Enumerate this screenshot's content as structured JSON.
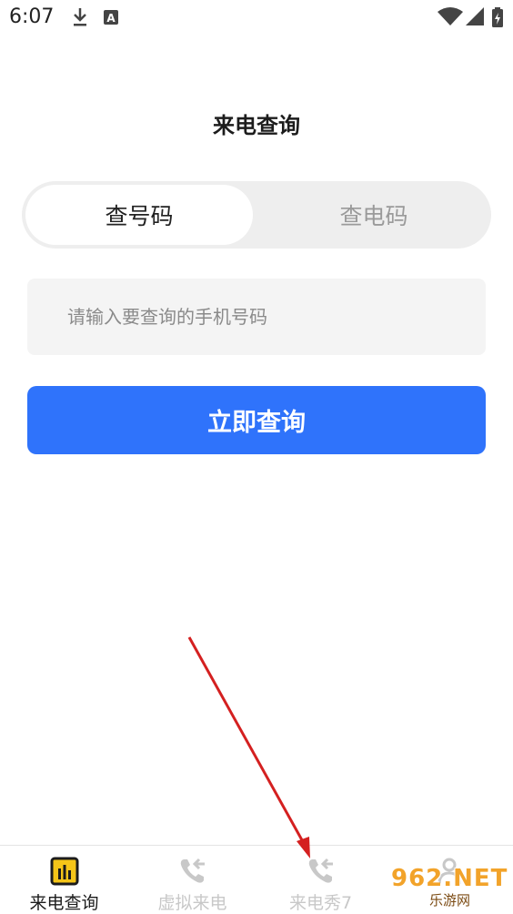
{
  "status_bar": {
    "time": "6:07",
    "icons": [
      "download-icon",
      "a-notification-icon",
      "wifi-icon",
      "signal-icon",
      "battery-icon"
    ]
  },
  "page": {
    "title": "来电查询"
  },
  "segmented": {
    "tabs": [
      {
        "label": "查号码",
        "active": true
      },
      {
        "label": "查电码",
        "active": false
      }
    ]
  },
  "search": {
    "placeholder": "请输入要查询的手机号码",
    "value": ""
  },
  "query_button": {
    "label": "立即查询"
  },
  "bottom_nav": {
    "items": [
      {
        "label": "来电查询",
        "icon": "bar-chart-icon",
        "active": true
      },
      {
        "label": "虚拟来电",
        "icon": "phone-callback-icon",
        "active": false
      },
      {
        "label": "来电秀7",
        "icon": "phone-callback-icon",
        "active": false
      },
      {
        "label": "",
        "icon": "person-icon",
        "active": false
      }
    ]
  },
  "watermark": {
    "main": "962.NET",
    "sub": "乐游网"
  },
  "colors": {
    "accent": "#2f73fb",
    "active_tab_bg": "#ffffff",
    "segment_bg": "#eeeeee",
    "input_bg": "#f4f4f4",
    "annotation_arrow": "#d42020",
    "nav_active_icon": "#f5c518"
  }
}
